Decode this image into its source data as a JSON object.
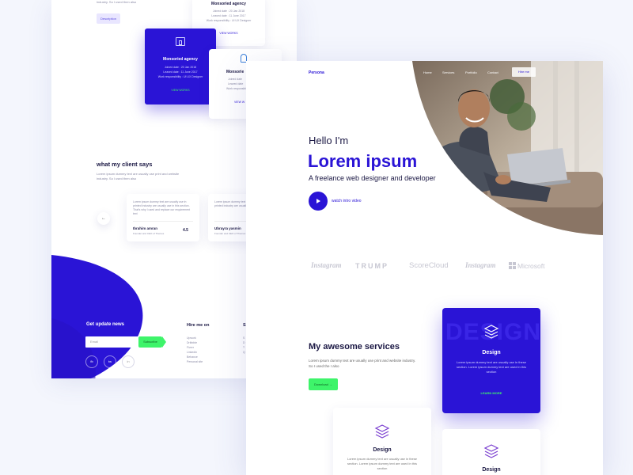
{
  "back": {
    "top_text": "industry. So I used then also",
    "top_button": "Description",
    "card_agency_top": {
      "title": "Monsoried agency",
      "lines": [
        "Joined date : 20 Jan 2018",
        "Leaved date : 11 June 2017",
        "Work responsibility : UI UX Designer"
      ],
      "link": "VIEW WORKS"
    },
    "card_agency_featured": {
      "title": "Monsoried agency",
      "lines": [
        "Joined date : 20 Jan 2018",
        "Leaved date : 11 June 2017",
        "Work responsibility : UI UX Designer"
      ],
      "link": "VIEW WORKS"
    },
    "card_agency_right": {
      "title": "Monsorie",
      "lines": [
        "Joined date",
        "Leaved date",
        "Work responsibil"
      ],
      "link": "VIEW W"
    },
    "clients": {
      "title": "what my client says",
      "desc": "Lorem ipsum dummy text are usually use print and website industry. So I used then also",
      "arrow": "←",
      "testimonials": [
        {
          "text": "Lorem ipsum dummy text are usually use in printed industry are usually use in this section. That's why I used and replace our requirement text",
          "name": "Ibrahim amran",
          "role": "Founder and CEO of Themes",
          "rating": "4.5"
        },
        {
          "text": "Lorem ipsum dummy text are usually use in printed industry are usually use in this section",
          "name": "Ubrayra yasmin",
          "role": "Founder and CEO of Themes"
        }
      ]
    },
    "footer": {
      "newsletter_title": "Get update news",
      "email_placeholder": "Email",
      "subscribe": "Subscribe",
      "social": [
        "fb",
        "tw",
        "in"
      ],
      "hire_title": "Hire me on",
      "hire_links": [
        "Upwork",
        "Dribbble",
        "Fiverr",
        "Linkedin",
        "Behance",
        "Personal site"
      ],
      "col3_title": "S",
      "col3_links": [
        "S",
        "D",
        "T",
        "Q"
      ]
    }
  },
  "front": {
    "logo": "Persona",
    "nav": [
      "Home",
      "Services",
      "Portfolio",
      "Contact"
    ],
    "hire_button": "Hire me",
    "hero": {
      "greeting": "Hello I'm",
      "name": "Lorem ipsum",
      "tagline": "A freelance web designer and developer",
      "video_label": "watch intro video"
    },
    "brands": [
      "Instagram",
      "TRUMP",
      "ScoreCloud",
      "Instagram",
      "Microsoft"
    ],
    "services": {
      "title": "My awesome services",
      "desc": "Lorem ipsum dummy text are usually use print and website industry. So I used the I also",
      "button": "Download →"
    },
    "service_cards": [
      {
        "title": "Design",
        "watermark": "DESIGN",
        "desc": "Lorem ipsum dummy text are usually use in these section. Lorem ipsum dummy text are used in this section",
        "link": "LEARN MORE",
        "featured": true
      },
      {
        "title": "Design",
        "desc": "Lorem ipsum dummy text are usually use in these section. Lorem ipsum dummy text are used in this section"
      },
      {
        "title": "Design",
        "desc": ""
      }
    ]
  },
  "colors": {
    "primary": "#2a14d6",
    "accent": "#3ef46a",
    "navy": "#1b1844"
  }
}
